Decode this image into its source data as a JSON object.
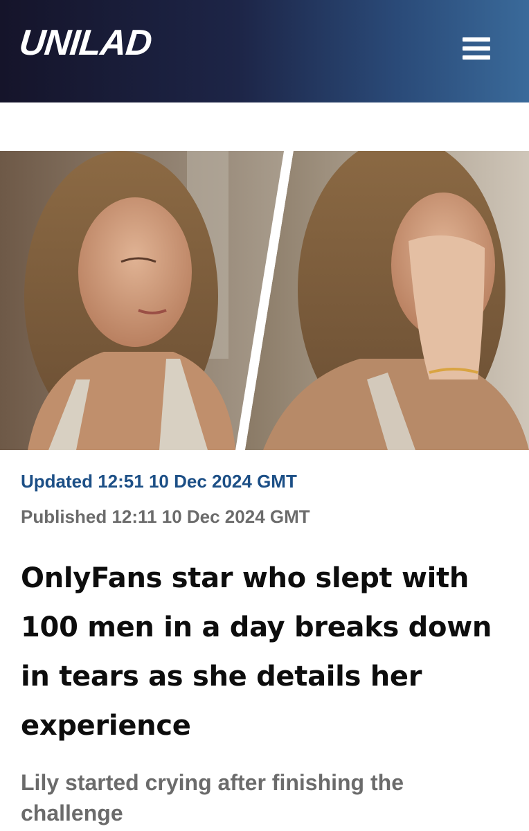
{
  "header": {
    "logo_text": "UNILAD",
    "menu_icon": "hamburger-menu-icon"
  },
  "hero": {
    "panels": [
      "left-photo",
      "right-photo"
    ],
    "colors": {
      "background": "#7a6552",
      "divider": "#ffffff"
    }
  },
  "article": {
    "updated": "Updated 12:51 10 Dec 2024 GMT",
    "published": "Published 12:11 10 Dec 2024 GMT",
    "headline": "OnlyFans star who slept with 100 men in a day breaks down in tears as she details her experience",
    "subheadline": "Lily started crying after finishing the challenge"
  },
  "colors": {
    "updated_text": "#1c4f86",
    "meta_text": "#6b6b6b",
    "headline_text": "#0d0d0d",
    "header_gradient_start": "#15142a",
    "header_gradient_end": "#3a6a9a"
  }
}
